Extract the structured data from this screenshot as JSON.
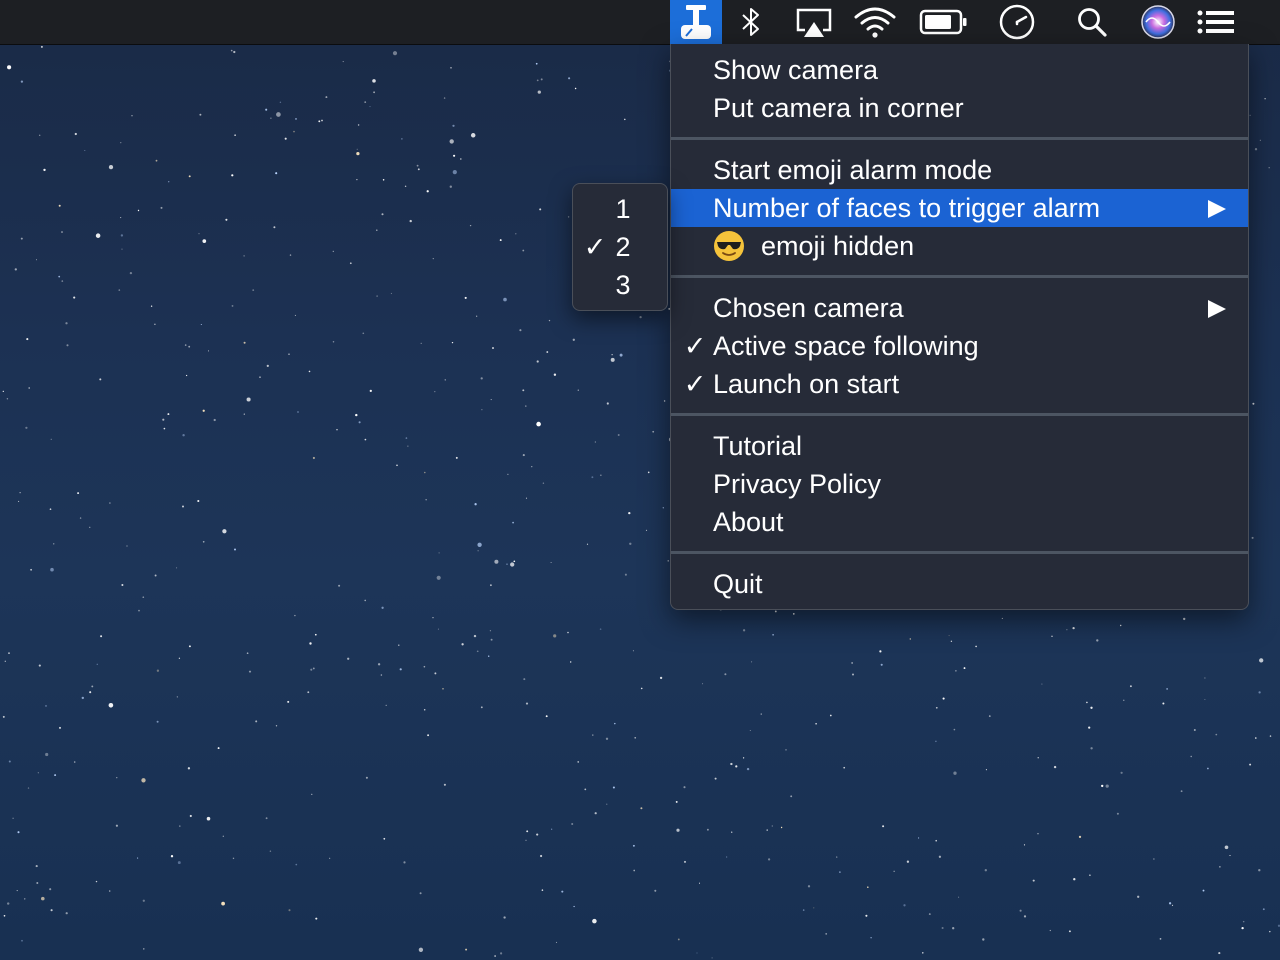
{
  "menubar": {
    "icons": [
      "camera-app-icon",
      "bluetooth-icon",
      "airplay-icon",
      "wifi-icon",
      "battery-icon",
      "clock-icon",
      "spotlight-search-icon",
      "siri-icon",
      "notification-center-icon"
    ],
    "accent": "#1c6ed9"
  },
  "menu": {
    "show_camera": "Show camera",
    "put_camera_in_corner": "Put camera in corner",
    "start_emoji_alarm_mode": "Start emoji alarm mode",
    "number_of_faces": "Number of faces to trigger alarm",
    "emoji_hidden": "emoji hidden",
    "chosen_camera": "Chosen camera",
    "active_space_following": "Active space following",
    "launch_on_start": "Launch on start",
    "tutorial": "Tutorial",
    "privacy_policy": "Privacy Policy",
    "about": "About",
    "quit": "Quit",
    "check": "✓",
    "highlight_color": "#1b63d3"
  },
  "submenu": {
    "items": [
      {
        "label": "1",
        "checked": false
      },
      {
        "label": "2",
        "checked": true
      },
      {
        "label": "3",
        "checked": false
      }
    ],
    "check": "✓"
  }
}
